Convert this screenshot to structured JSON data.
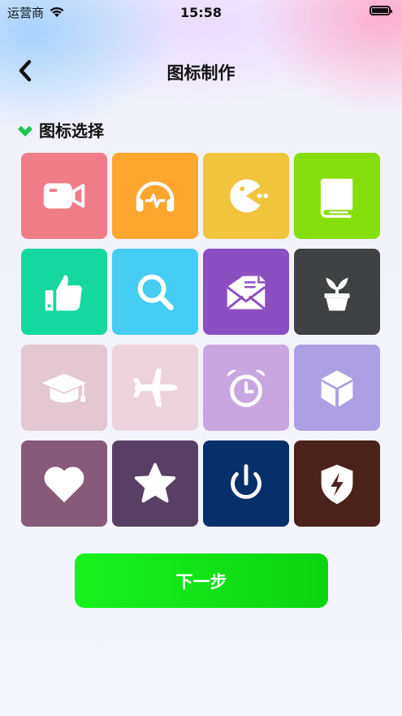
{
  "status": {
    "carrier": "运营商",
    "time": "15:58"
  },
  "nav": {
    "title": "图标制作"
  },
  "section": {
    "title": "图标选择",
    "accent_color": "#16c94a"
  },
  "tiles": [
    {
      "name": "video-camera-icon",
      "color": "#f07c88"
    },
    {
      "name": "headphones-icon",
      "color": "#ffa62f"
    },
    {
      "name": "pacman-icon",
      "color": "#f0c43d"
    },
    {
      "name": "book-icon",
      "color": "#86de0c"
    },
    {
      "name": "thumbs-up-icon",
      "color": "#14d8a0"
    },
    {
      "name": "search-icon",
      "color": "#45cdf3"
    },
    {
      "name": "envelope-icon",
      "color": "#8c4fc2"
    },
    {
      "name": "plant-pot-icon",
      "color": "#404142"
    },
    {
      "name": "graduation-cap-icon",
      "color": "#e3c8d1"
    },
    {
      "name": "airplane-icon",
      "color": "#ecd2da"
    },
    {
      "name": "alarm-clock-icon",
      "color": "#c8a6e2"
    },
    {
      "name": "cube-icon",
      "color": "#ad9fe3"
    },
    {
      "name": "heart-icon",
      "color": "#875a7a"
    },
    {
      "name": "star-icon",
      "color": "#574063"
    },
    {
      "name": "power-icon",
      "color": "#05306a"
    },
    {
      "name": "shield-bolt-icon",
      "color": "#4a221b"
    }
  ],
  "next_button": {
    "label": "下一步"
  }
}
